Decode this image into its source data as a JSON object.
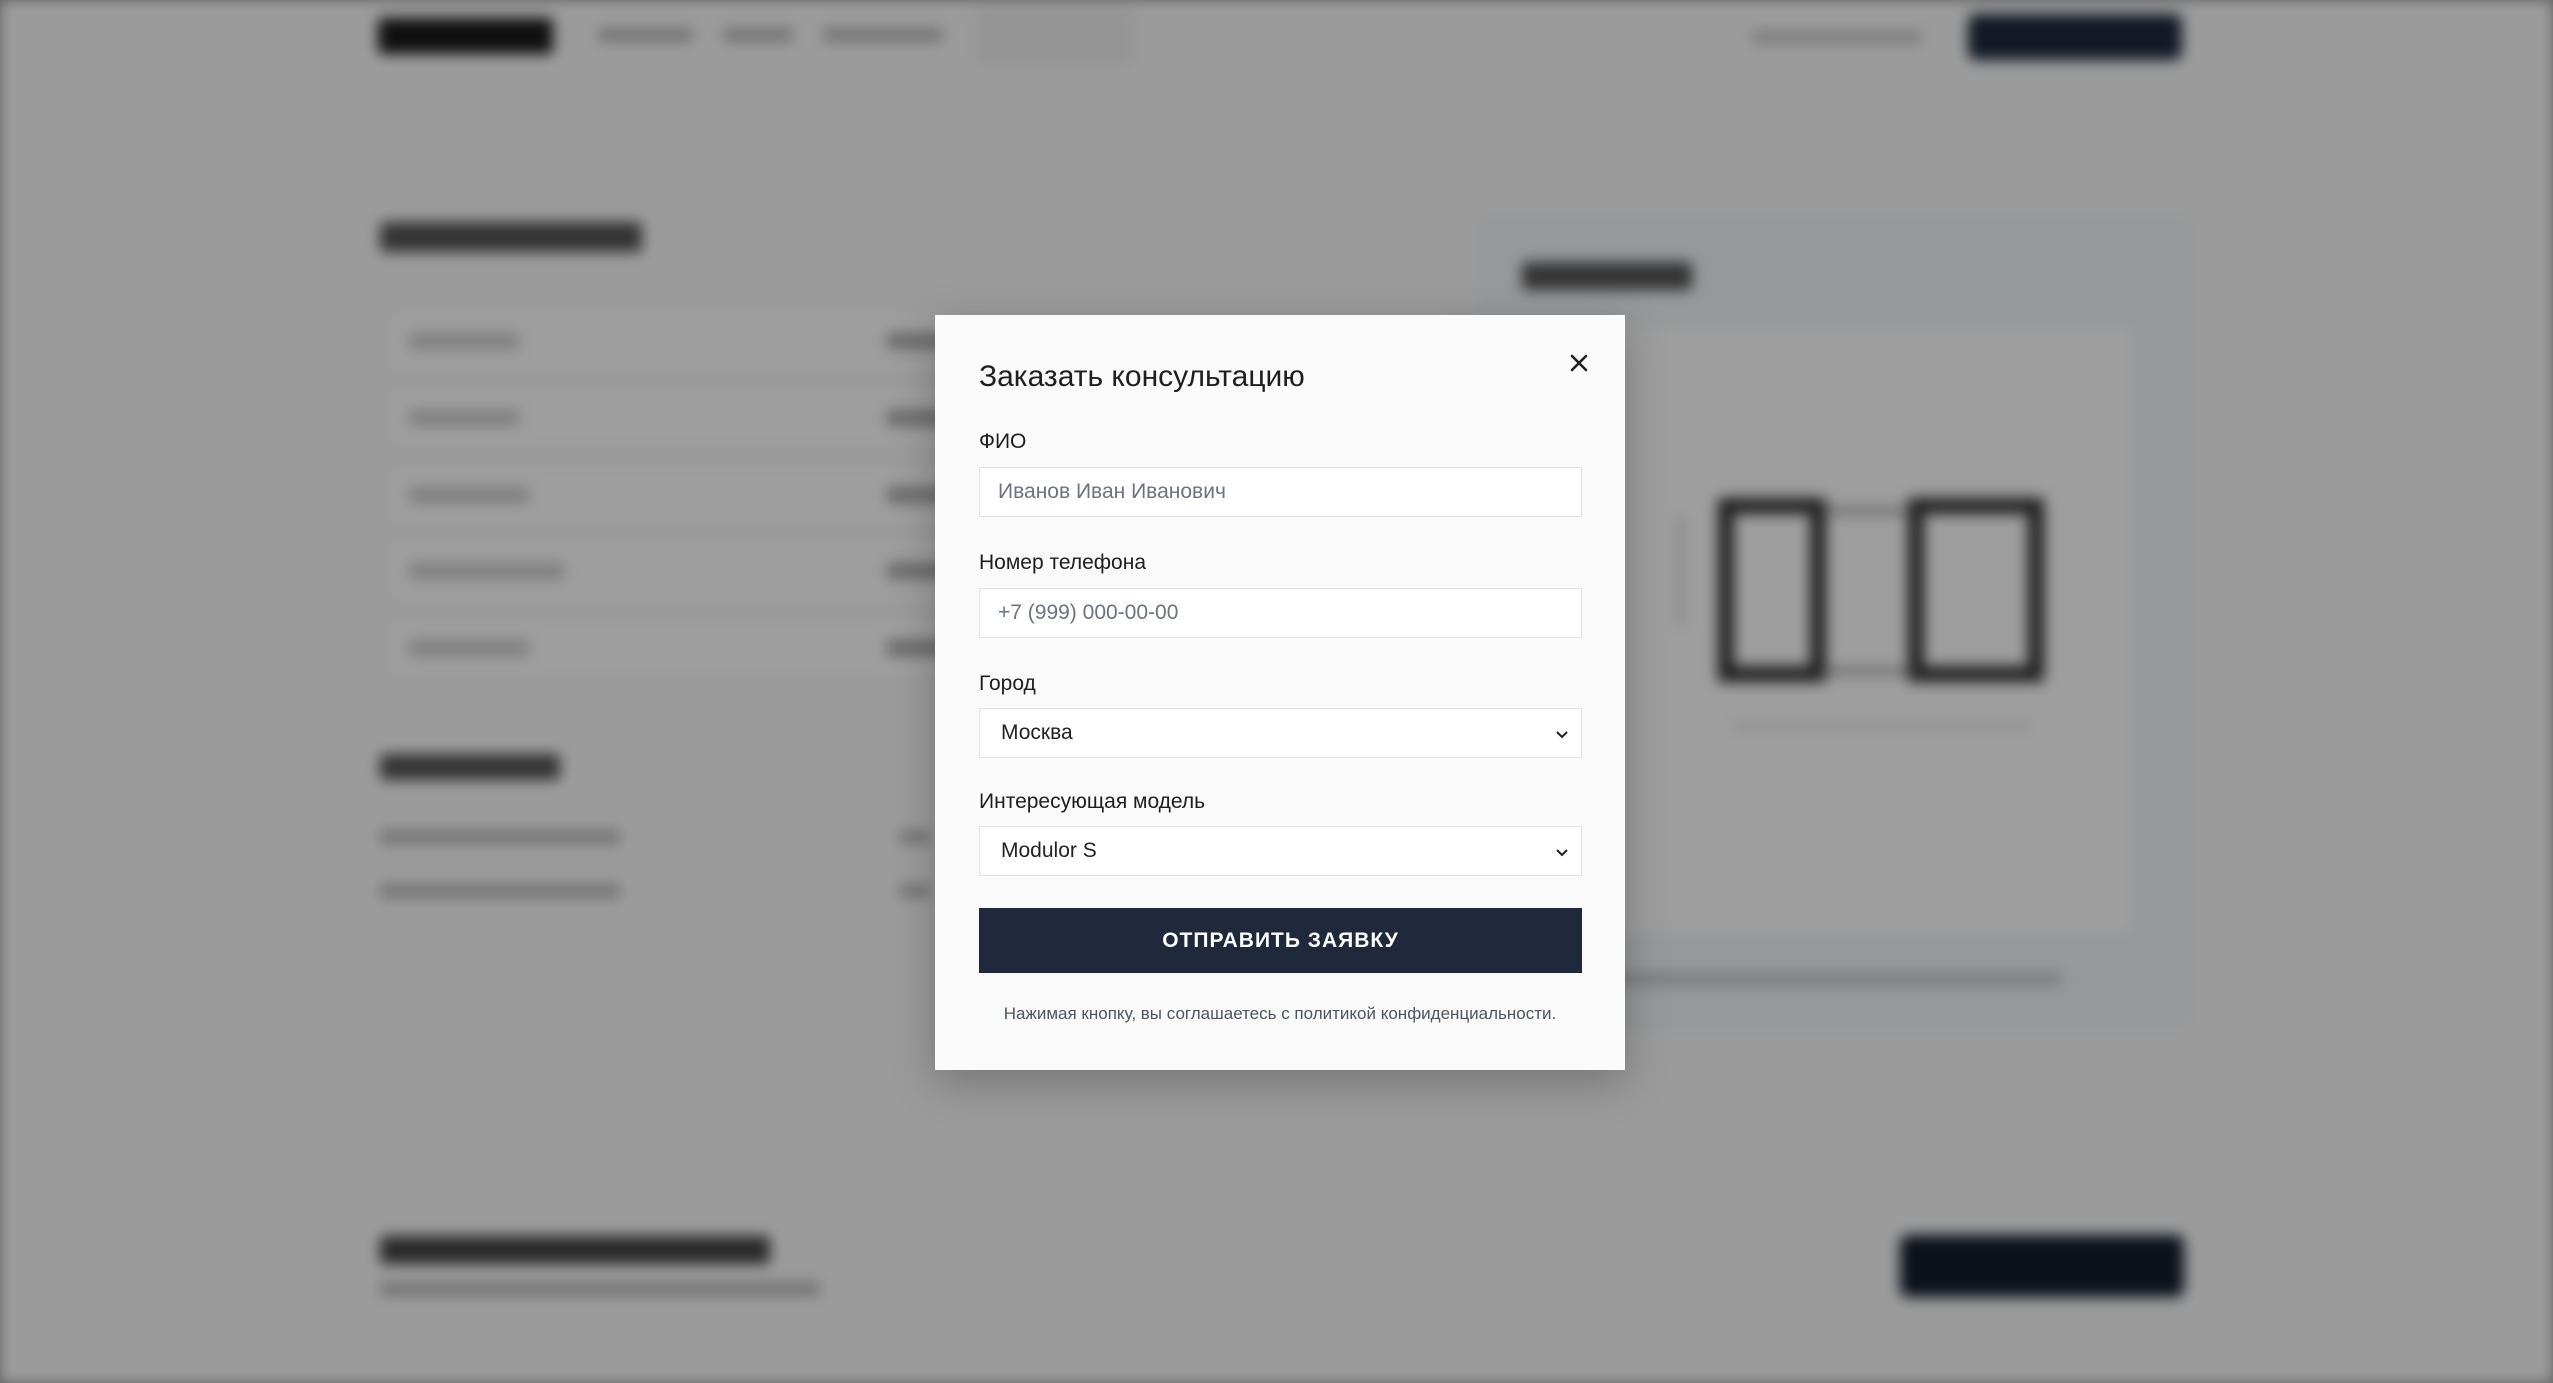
{
  "modal": {
    "title": "Заказать консультацию",
    "fields": {
      "name": {
        "label": "ФИО",
        "placeholder": "Иванов Иван Иванович"
      },
      "phone": {
        "label": "Номер телефона",
        "placeholder": "+7 (999) 000-00-00"
      },
      "city": {
        "label": "Город",
        "value": "Москва"
      },
      "model": {
        "label": "Интересующая модель",
        "value": "Modulor S"
      }
    },
    "submit_label": "ОТПРАВИТЬ ЗАЯВКУ",
    "consent": "Нажимая кнопку, вы соглашаетесь с политикой конфиденциальности."
  },
  "colors": {
    "primary": "#1f293b",
    "overlay": "#000000"
  },
  "icons": {
    "close": "close-icon",
    "select_arrow": "chevron-down-icon"
  }
}
